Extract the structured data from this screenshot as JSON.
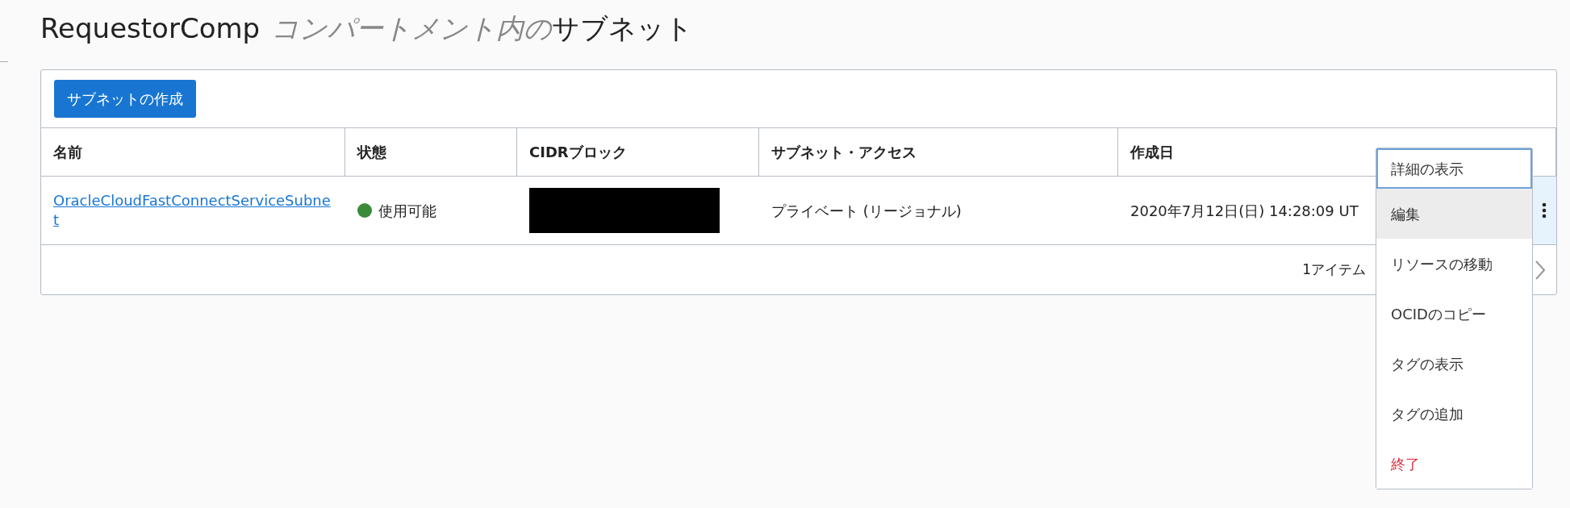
{
  "header": {
    "compartment": "RequestorComp",
    "middle": "コンパートメント内の",
    "title": "サブネット"
  },
  "create_button": "サブネットの作成",
  "table": {
    "columns": [
      "名前",
      "状態",
      "CIDRブロック",
      "サブネット・アクセス",
      "作成日"
    ],
    "rows": [
      {
        "name": "OracleCloudFastConnectServiceSubnet",
        "status": {
          "label": "使用可能",
          "color": "#3a8a3a"
        },
        "cidr_redacted": true,
        "access": "プライベート (リージョナル)",
        "created": "2020年7月12日(日) 14:28:09 UT",
        "selected": true
      }
    ]
  },
  "pager": {
    "text": "1アイテム"
  },
  "menu": {
    "items": [
      {
        "label": "詳細の表示",
        "kind": "normal",
        "focused": true,
        "hovered": false
      },
      {
        "label": "編集",
        "kind": "normal",
        "focused": false,
        "hovered": true
      },
      {
        "label": "リソースの移動",
        "kind": "normal",
        "focused": false,
        "hovered": false
      },
      {
        "label": "OCIDのコピー",
        "kind": "normal",
        "focused": false,
        "hovered": false
      },
      {
        "label": "タグの表示",
        "kind": "normal",
        "focused": false,
        "hovered": false
      },
      {
        "label": "タグの追加",
        "kind": "normal",
        "focused": false,
        "hovered": false
      },
      {
        "label": "終了",
        "kind": "danger",
        "focused": false,
        "hovered": false
      }
    ]
  }
}
